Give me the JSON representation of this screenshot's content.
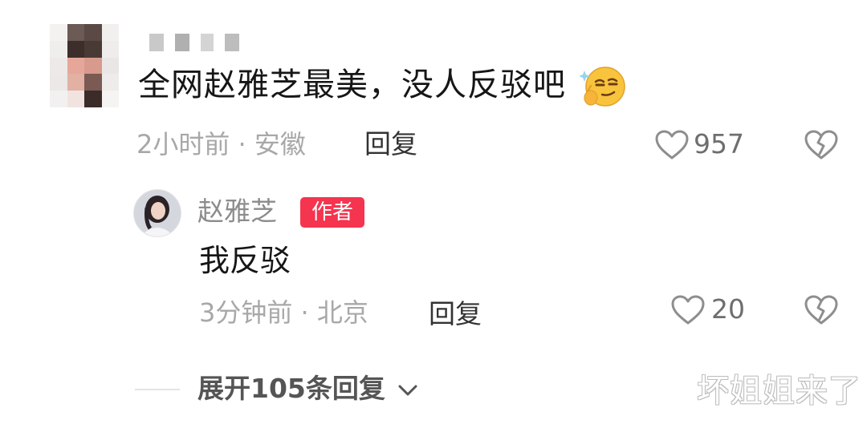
{
  "comment": {
    "text": "全网赵雅芝最美，没人反驳吧",
    "emoji": "thinking-smirk-emoji",
    "time_location": "2小时前 · 安徽",
    "reply_label": "回复",
    "like_count": "957"
  },
  "reply": {
    "author_name": "赵雅芝",
    "author_badge": "作者",
    "text": "我反驳",
    "time_location": "3分钟前 · 北京",
    "reply_label": "回复",
    "like_count": "20"
  },
  "expand": {
    "label": "展开105条回复"
  },
  "watermark": "坏姐姐来了",
  "colors": {
    "badge": "#f5344f",
    "text_primary": "#161616",
    "text_meta": "#a8a8a8",
    "icon": "#9a9a9a"
  }
}
